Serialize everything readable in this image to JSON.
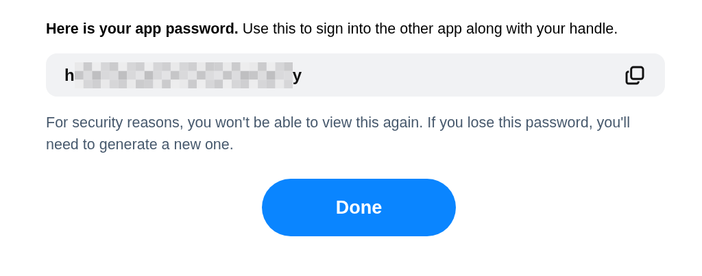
{
  "intro": "**Here is your app password.** Use this to sign into the other app along with your handle.",
  "password": {
    "start": "h",
    "end": "y",
    "redacted": true
  },
  "note": "For security reasons, you won't be able to view this again. If you lose this password, you'll need to generate a new one.",
  "button": {
    "label": "Done"
  }
}
